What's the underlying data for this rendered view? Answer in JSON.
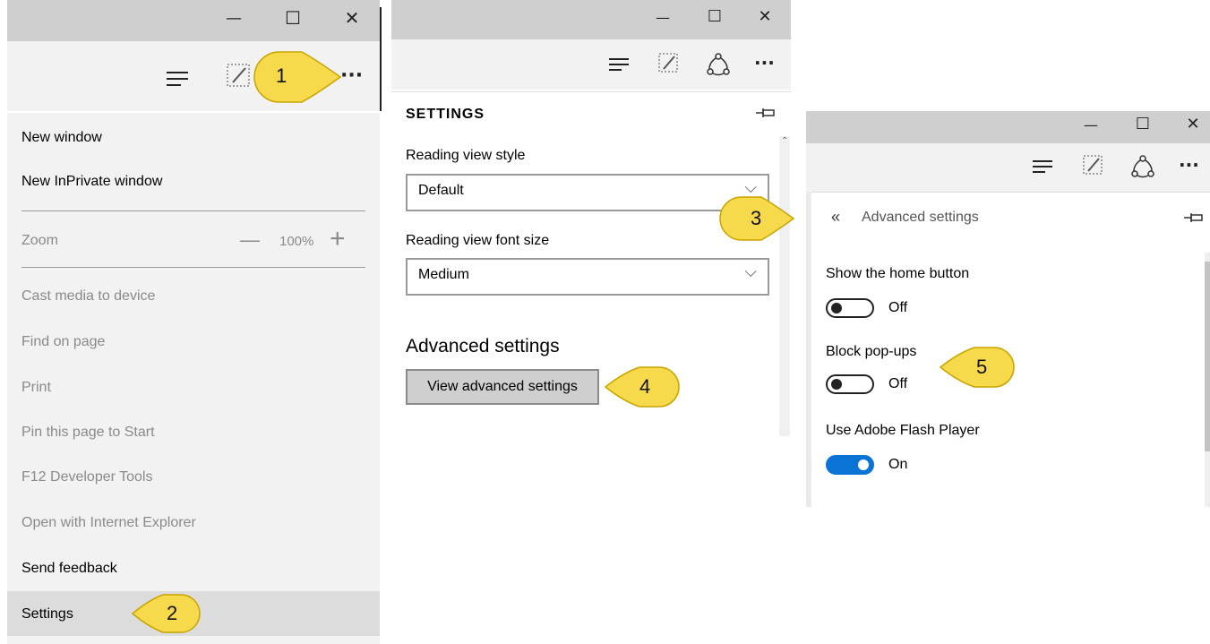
{
  "panel1": {
    "window_controls": {
      "minimize": "—",
      "maximize": "☐",
      "close": "✕"
    },
    "toolbar_icons": [
      "hub-icon",
      "web-note-icon",
      "more-icon"
    ],
    "more_label": "···",
    "menu": {
      "new_window": "New window",
      "new_inprivate": "New InPrivate window",
      "zoom_label": "Zoom",
      "zoom_minus": "—",
      "zoom_value": "100%",
      "zoom_plus": "+",
      "cast": "Cast media to device",
      "find": "Find on page",
      "print": "Print",
      "pin": "Pin this page to Start",
      "devtools": "F12 Developer Tools",
      "open_ie": "Open with Internet Explorer",
      "feedback": "Send feedback",
      "settings": "Settings"
    },
    "callout1": "1",
    "callout2": "2"
  },
  "panel2": {
    "window_controls": {
      "minimize": "—",
      "maximize": "☐",
      "close": "✕"
    },
    "more_label": "···",
    "settings_title": "SETTINGS",
    "pin_icon": "⊣◻",
    "reading_style_label": "Reading view style",
    "reading_style_value": "Default",
    "reading_font_label": "Reading view font size",
    "reading_font_value": "Medium",
    "advanced_heading": "Advanced settings",
    "view_advanced_button": "View advanced settings",
    "callout3": "3",
    "callout4": "4"
  },
  "panel3": {
    "window_controls": {
      "minimize": "—",
      "maximize": "☐",
      "close": "✕"
    },
    "more_label": "···",
    "back_icon": "«",
    "title": "Advanced settings",
    "home_label": "Show the home button",
    "home_state": "Off",
    "popups_label": "Block pop-ups",
    "popups_state": "Off",
    "flash_label": "Use Adobe Flash Player",
    "flash_state": "On",
    "callout5": "5"
  },
  "colors": {
    "toggle_on": "#0a74d6",
    "callout_fill": "#f7d94c",
    "titlebar": "#cfcfcf",
    "selected_row": "#dcdcdc"
  }
}
